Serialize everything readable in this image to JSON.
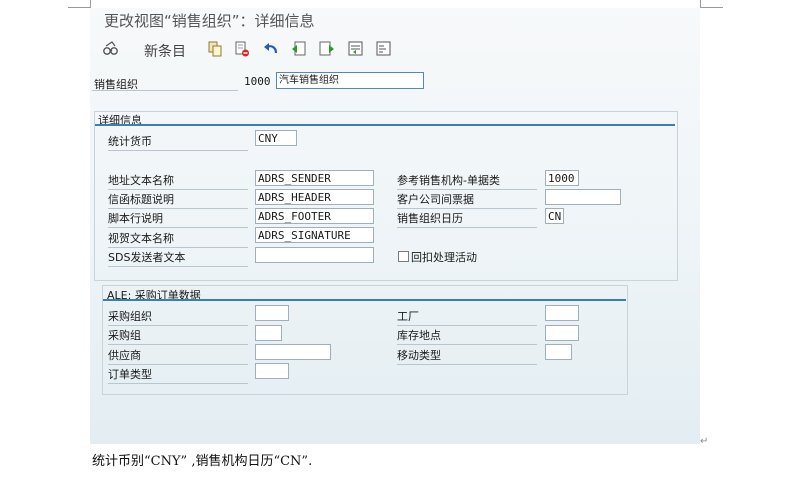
{
  "window": {
    "title": "更改视图“销售组织”：详细信息"
  },
  "toolbar": {
    "glasses_icon": "glasses-icon",
    "new_entries_label": "新条目",
    "icons": [
      "copy-icon",
      "delete-icon",
      "undo-icon",
      "previous-entry-icon",
      "next-entry-icon",
      "select-all-icon",
      "block-icon"
    ]
  },
  "header": {
    "sales_org_label": "销售组织",
    "sales_org_code": "1000",
    "sales_org_name": "汽车销售组织"
  },
  "details": {
    "group_title": "详细信息",
    "stat_currency_label": "统计货币",
    "stat_currency_value": "CNY",
    "address_text_label": "地址文本名称",
    "address_text_value": "ADRS_SENDER",
    "letter_header_label": "信函标题说明",
    "letter_header_value": "ADRS_HEADER",
    "footer_label": "脚本行说明",
    "footer_value": "ADRS_FOOTER",
    "signature_label": "视贺文本名称",
    "signature_value": "ADRS_SIGNATURE",
    "sds_sender_label": "SDS发送者文本",
    "sds_sender_value": "",
    "ref_sales_org_label": "参考销售机构-单据类",
    "ref_sales_org_value": "1000",
    "intercompany_billing_label": "客户公司间票据",
    "intercompany_billing_value": "",
    "sales_org_calendar_label": "销售组织日历",
    "sales_org_calendar_value": "CN",
    "rebate_processing_label": "回扣处理活动",
    "rebate_processing_checked": false
  },
  "ale": {
    "group_title": "ALE: 采购订单数据",
    "purch_org_label": "采购组织",
    "purch_org_value": "",
    "purch_group_label": "采购组",
    "purch_group_value": "",
    "vendor_label": "供应商",
    "vendor_value": "",
    "order_type_label": "订单类型",
    "order_type_value": "",
    "plant_label": "工厂",
    "plant_value": "",
    "storage_loc_label": "库存地点",
    "storage_loc_value": "",
    "movement_type_label": "移动类型",
    "movement_type_value": ""
  },
  "document": {
    "caption": "统计币别“CNY” ,销售机构日历“CN”.",
    "paragraph_mark": "↵"
  }
}
